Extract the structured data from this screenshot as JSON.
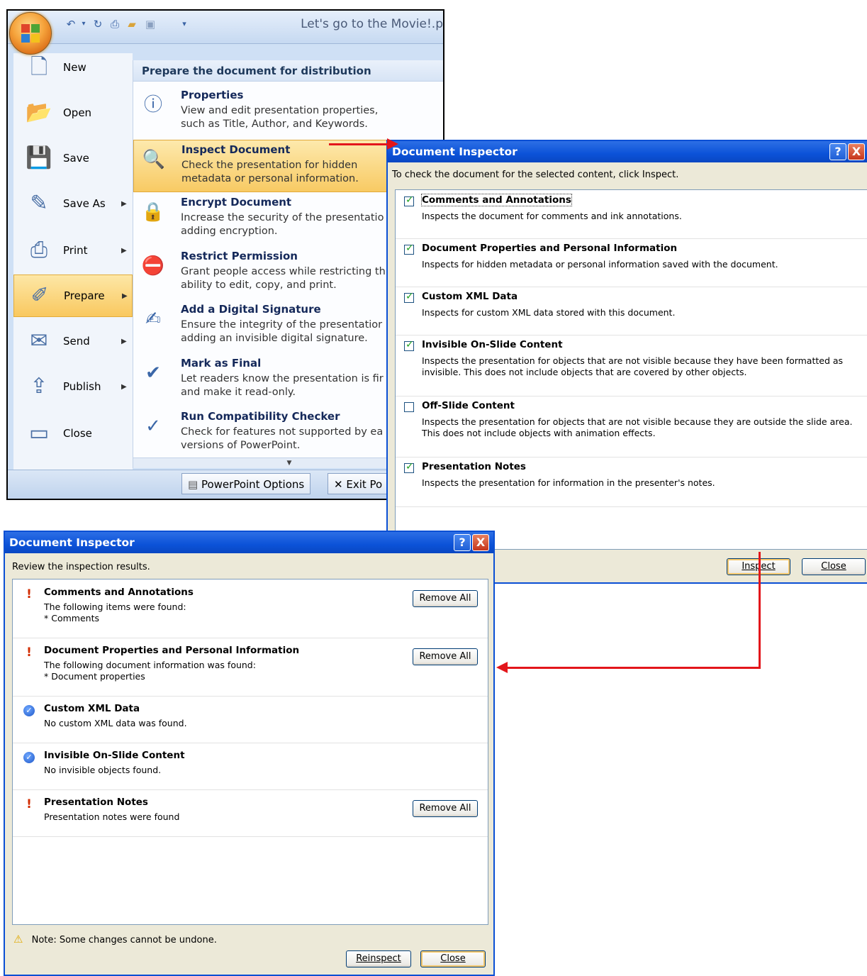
{
  "office_menu": {
    "quick_access_title": "Let's go to the Movie!.p",
    "menu_items": [
      {
        "label": "New",
        "icon": "new-document-icon",
        "has_arrow": false
      },
      {
        "label": "Open",
        "icon": "open-folder-icon",
        "has_arrow": false
      },
      {
        "label": "Save",
        "icon": "save-disk-icon",
        "has_arrow": false
      },
      {
        "label": "Save As",
        "icon": "save-as-icon",
        "has_arrow": true
      },
      {
        "label": "Print",
        "icon": "printer-icon",
        "has_arrow": true
      },
      {
        "label": "Prepare",
        "icon": "prepare-icon",
        "has_arrow": true,
        "active": true
      },
      {
        "label": "Send",
        "icon": "send-icon",
        "has_arrow": true
      },
      {
        "label": "Publish",
        "icon": "publish-icon",
        "has_arrow": true
      },
      {
        "label": "Close",
        "icon": "close-folder-icon",
        "has_arrow": false
      }
    ],
    "prepare_header": "Prepare the document for distribution",
    "prepare_items": [
      {
        "title": "Properties",
        "desc": "View and edit presentation properties,\nsuch as Title, Author, and Keywords.",
        "icon": "properties-icon"
      },
      {
        "title": "Inspect Document",
        "desc": "Check the presentation for hidden\nmetadata or personal information.",
        "icon": "inspect-document-icon",
        "active": true
      },
      {
        "title": "Encrypt Document",
        "desc": "Increase the security of the presentatio\nadding encryption.",
        "icon": "encrypt-lock-icon"
      },
      {
        "title": "Restrict Permission",
        "desc": "Grant people access while restricting th\nability to edit, copy, and print.",
        "icon": "restrict-permission-icon"
      },
      {
        "title": "Add a Digital Signature",
        "desc": "Ensure the integrity of the presentatior\nadding an invisible digital signature.",
        "icon": "digital-signature-icon"
      },
      {
        "title": "Mark as Final",
        "desc": "Let readers know the presentation is fir\nand make it read-only.",
        "icon": "mark-final-icon"
      },
      {
        "title": "Run Compatibility Checker",
        "desc": "Check for features not supported by ea\nversions of PowerPoint.",
        "icon": "compatibility-checker-icon"
      }
    ],
    "options_button": "PowerPoint Options",
    "exit_button": "Exit Po"
  },
  "inspector_dialog": {
    "title": "Document Inspector",
    "help_glyph": "?",
    "close_glyph": "X",
    "instruction": "To check the document for the selected content, click Inspect.",
    "options": [
      {
        "title": "Comments and Annotations",
        "desc": "Inspects the document for comments and ink annotations.",
        "checked": true
      },
      {
        "title": "Document Properties and Personal Information",
        "desc": "Inspects for hidden metadata or personal information saved with the document.",
        "checked": true
      },
      {
        "title": "Custom XML Data",
        "desc": "Inspects for custom XML data stored with this document.",
        "checked": true
      },
      {
        "title": "Invisible On-Slide Content",
        "desc": "Inspects the presentation for objects that are not visible because they have been formatted as invisible. This does not include objects that are covered by other objects.",
        "checked": true
      },
      {
        "title": "Off-Slide Content",
        "desc": "Inspects the presentation for objects that are not visible because they are outside the slide area. This does not include objects with animation effects.",
        "checked": false
      },
      {
        "title": "Presentation Notes",
        "desc": "Inspects the presentation for information in the presenter's notes.",
        "checked": true
      }
    ],
    "inspect_button": "Inspect",
    "close_button": "Close"
  },
  "results_dialog": {
    "title": "Document Inspector",
    "help_glyph": "?",
    "close_glyph": "X",
    "instruction": "Review the inspection results.",
    "results": [
      {
        "title": "Comments and Annotations",
        "desc": "The following items were found:\n* Comments",
        "status": "found",
        "button": "Remove All"
      },
      {
        "title": "Document Properties and Personal Information",
        "desc": "The following document information was found:\n* Document properties",
        "status": "found",
        "button": "Remove All"
      },
      {
        "title": "Custom XML Data",
        "desc": "No custom XML data was found.",
        "status": "ok"
      },
      {
        "title": "Invisible On-Slide Content",
        "desc": "No invisible objects found.",
        "status": "ok"
      },
      {
        "title": "Presentation Notes",
        "desc": "Presentation notes were found",
        "status": "found",
        "button": "Remove All"
      }
    ],
    "note": "Note: Some changes cannot be undone.",
    "reinspect_button": "Reinspect",
    "close_button": "Close"
  },
  "colors": {
    "arrow": "#e3161b",
    "title_bar": "#0b52d8",
    "menu_highlight": "#f9c85f"
  }
}
